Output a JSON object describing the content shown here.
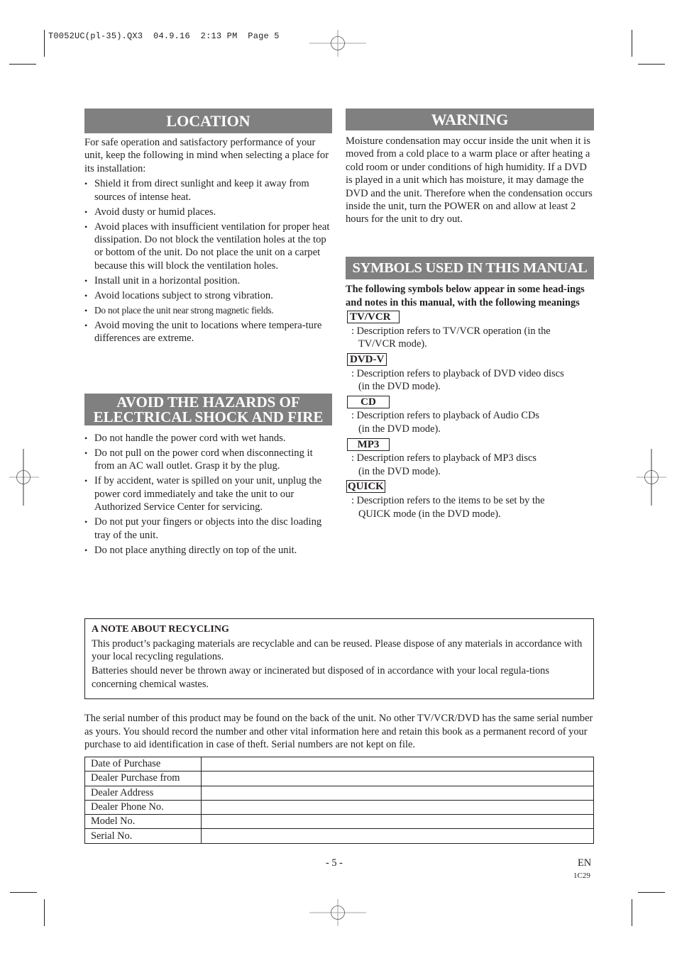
{
  "slug": {
    "filename": "T0052UC(pl-35).QX3",
    "date": "04.9.16",
    "time": "2:13 PM",
    "page": "Page 5"
  },
  "colors": {
    "header_bar": "#808080",
    "header_text": "#ffffff",
    "text": "#231f20"
  },
  "location": {
    "title": "LOCATION",
    "intro": "For safe operation and satisfactory performance of your unit, keep the following in mind when selecting a place for its installation:",
    "items": [
      "Shield it from direct sunlight and keep it away from sources of intense heat.",
      "Avoid dusty or humid places.",
      "Avoid places with insufficient ventilation for proper heat dissipation. Do not block the ventilation holes at the top or bottom of the unit. Do not place the unit on a carpet because this will block the ventilation holes.",
      "Install unit in a horizontal position.",
      "Avoid locations subject to strong vibration.",
      "Do not place the unit near strong magnetic fields.",
      "Avoid moving the unit to locations where tempera-ture differences are extreme."
    ]
  },
  "hazards": {
    "title_line1": "AVOID THE HAZARDS OF",
    "title_line2": "ELECTRICAL SHOCK AND FIRE",
    "items": [
      "Do not handle the power cord with wet hands.",
      "Do not pull on the power cord when disconnecting it from an AC wall outlet. Grasp it by the plug.",
      "If by accident, water is spilled on your unit, unplug the power cord immediately and take the unit to our Authorized Service Center for servicing.",
      "Do not put your fingers or objects into the disc loading tray of the unit.",
      "Do not place anything directly on top of the unit."
    ]
  },
  "warning": {
    "title": "WARNING",
    "body": "Moisture condensation may occur inside the unit when it is moved from a cold place to a warm place or after heating a cold room or under conditions of high humidity. If a DVD is played in a unit which has moisture, it may damage the DVD and the unit. Therefore when the condensation occurs inside the unit, turn the POWER on and allow at least 2 hours for the unit to dry out."
  },
  "symbols": {
    "title": "SYMBOLS USED IN THIS MANUAL",
    "intro": "The following symbols below appear in some head-ings and notes in this manual, with the following meanings",
    "items": [
      {
        "label": "TV/VCR",
        "desc_line1": ": Description refers to TV/VCR operation (in the",
        "desc_line2": "TV/VCR mode)."
      },
      {
        "label": "DVD-V",
        "desc_line1": ": Description refers to playback of DVD video discs",
        "desc_line2": "(in the DVD mode)."
      },
      {
        "label": "CD",
        "desc_line1": ": Description refers to playback of Audio CDs",
        "desc_line2": "(in the DVD mode)."
      },
      {
        "label": "MP3",
        "desc_line1": ": Description refers to playback of  MP3 discs",
        "desc_line2": "(in the DVD mode)."
      },
      {
        "label": "QUICK",
        "desc_line1": ": Description refers to the items to be set by the",
        "desc_line2": "QUICK mode (in the DVD mode)."
      }
    ]
  },
  "recycling": {
    "title": "A NOTE ABOUT RECYCLING",
    "para1": "This product’s packaging materials are recyclable and can be reused. Please dispose of any materials in accordance with your local recycling regulations.",
    "para2": "Batteries should never be thrown away or incinerated but disposed of in accordance with your local regula-tions concerning chemical wastes."
  },
  "serial_note": "The serial number of this product may be found on the back of the unit. No other TV/VCR/DVD has the same serial number as yours. You should record the number and other vital information here and retain this book as a permanent record of your purchase to aid identification in case of theft. Serial numbers are not kept on file.",
  "record_table": {
    "rows": [
      {
        "label": "Date of Purchase",
        "value": ""
      },
      {
        "label": "Dealer Purchase from",
        "value": ""
      },
      {
        "label": "Dealer Address",
        "value": ""
      },
      {
        "label": "Dealer Phone No.",
        "value": ""
      },
      {
        "label": "Model No.",
        "value": ""
      },
      {
        "label": "Serial No.",
        "value": ""
      }
    ]
  },
  "footer": {
    "page_number": "- 5 -",
    "language": "EN",
    "code": "1C29"
  }
}
